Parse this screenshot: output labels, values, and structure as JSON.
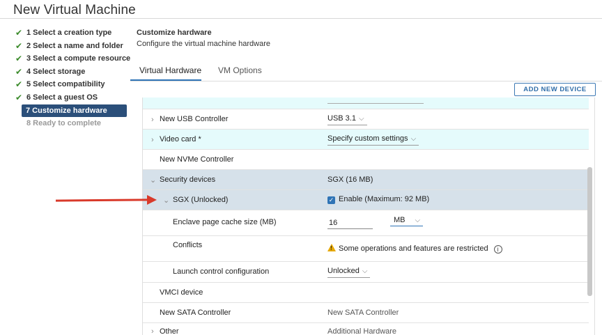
{
  "window": {
    "title": "New Virtual Machine"
  },
  "steps": [
    {
      "label": "1 Select a creation type",
      "state": "done"
    },
    {
      "label": "2 Select a name and folder",
      "state": "done"
    },
    {
      "label": "3 Select a compute resource",
      "state": "done"
    },
    {
      "label": "4 Select storage",
      "state": "done"
    },
    {
      "label": "5 Select compatibility",
      "state": "done"
    },
    {
      "label": "6 Select a guest OS",
      "state": "done"
    },
    {
      "label": "7 Customize hardware",
      "state": "active"
    },
    {
      "label": "8 Ready to complete",
      "state": "disabled"
    }
  ],
  "page": {
    "heading": "Customize hardware",
    "subheading": "Configure the virtual machine hardware"
  },
  "tabs": [
    {
      "label": "Virtual Hardware",
      "active": true
    },
    {
      "label": "VM Options",
      "active": false
    }
  ],
  "toolbar": {
    "add_device_label": "ADD NEW DEVICE"
  },
  "hardware": {
    "usb": {
      "label": "New USB Controller",
      "value": "USB 3.1"
    },
    "video": {
      "label": "Video card *",
      "value": "Specify custom settings"
    },
    "nvme": {
      "label": "New NVMe Controller"
    },
    "security": {
      "label": "Security devices",
      "value": "SGX (16 MB)"
    },
    "sgx": {
      "label": "SGX (Unlocked)",
      "enable_label": "Enable (Maximum: 92 MB)",
      "enabled": true
    },
    "epc": {
      "label": "Enclave page cache size (MB)",
      "value": "16",
      "unit": "MB"
    },
    "conflicts": {
      "label": "Conflicts",
      "message": "Some operations and features are restricted"
    },
    "launch": {
      "label": "Launch control configuration",
      "value": "Unlocked"
    },
    "vmci": {
      "label": "VMCI device"
    },
    "sata": {
      "label": "New SATA Controller",
      "value": "New SATA Controller"
    },
    "other": {
      "label": "Other",
      "value": "Additional Hardware"
    }
  },
  "colors": {
    "accent": "#2f74b6",
    "active_step": "#2b4f7a",
    "selected_row": "#d6e1ea",
    "new_row": "#e5fbfc",
    "annotation_arrow": "#d93a2b",
    "check": "#3a8a2a",
    "warning": "#e6a800"
  },
  "icons": [
    "check-icon",
    "chevron-right-icon",
    "chevron-down-icon",
    "caret-down-icon",
    "checkbox-checked-icon",
    "warning-icon",
    "info-icon"
  ]
}
